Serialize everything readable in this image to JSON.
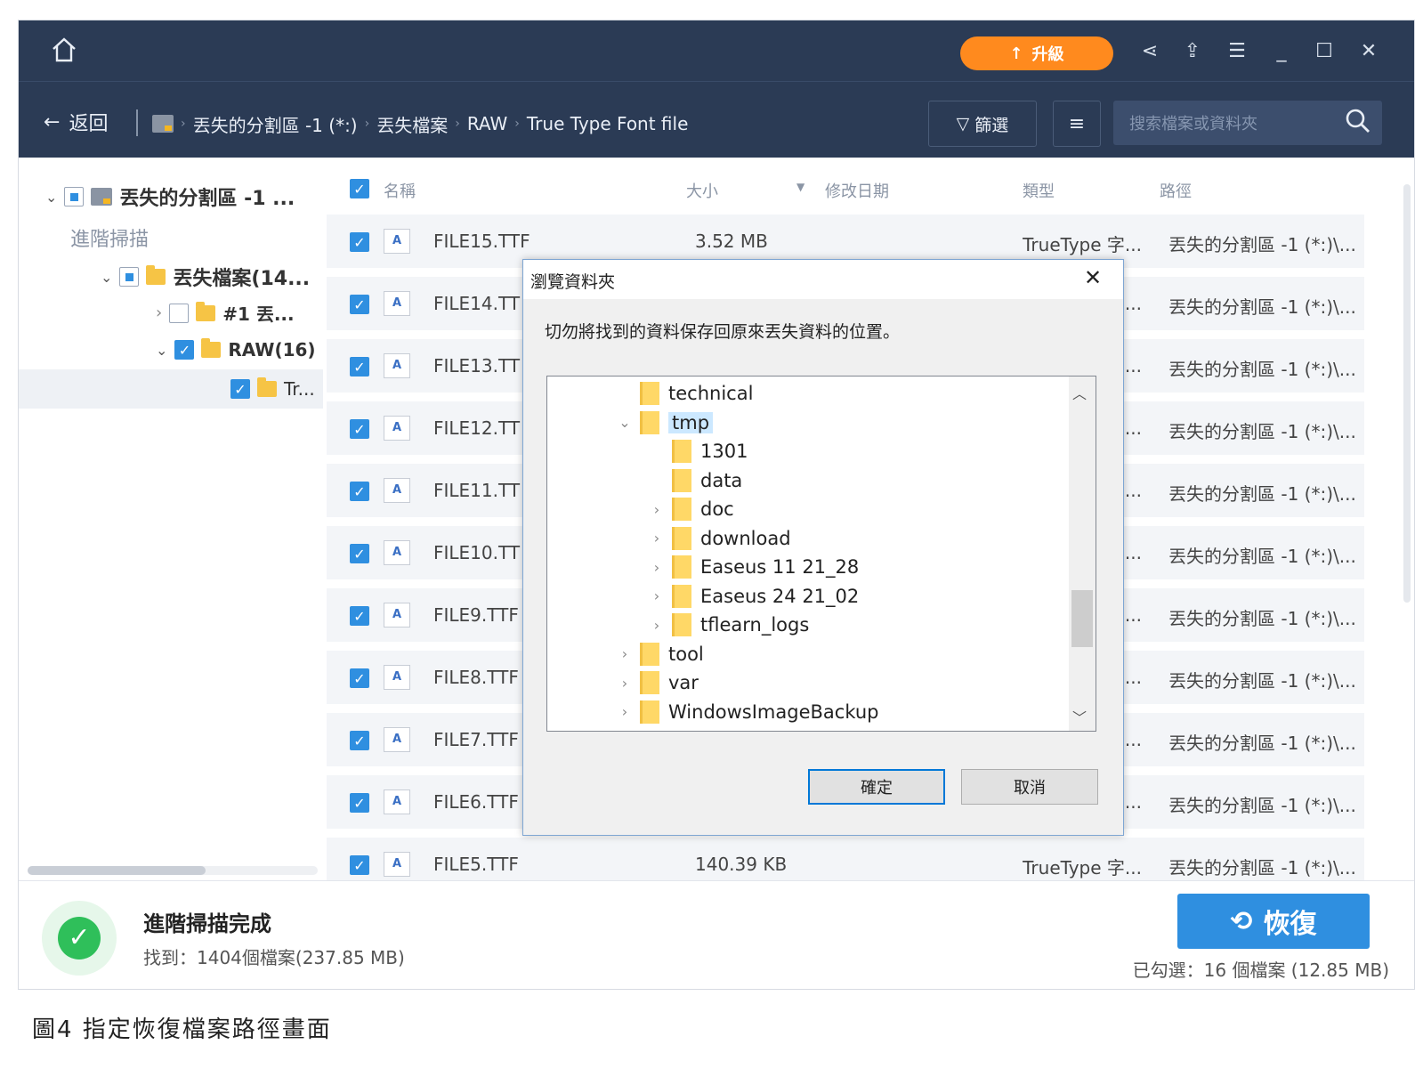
{
  "titlebar": {
    "home_icon": "home-icon",
    "upgrade_label": "升級",
    "icons": [
      "share-icon",
      "export-icon",
      "menu-icon",
      "minimize-icon",
      "maximize-icon",
      "close-icon"
    ]
  },
  "nav": {
    "back_label": "返回",
    "breadcrumb": [
      "丟失的分割區 -1 (*:)",
      "丟失檔案",
      "RAW",
      "True Type Font file"
    ],
    "filter_label": "篩選",
    "search_placeholder": "搜索檔案或資料夾"
  },
  "sidebar": {
    "root_label": "丟失的分割區 -1 ...",
    "advanced_scan_label": "進階掃描",
    "lost_files_label": "丟失檔案(14...",
    "item1_label": "#1 丟...",
    "raw_label": "RAW(16)",
    "tr_label": "Tr..."
  },
  "table": {
    "headers": {
      "name": "名稱",
      "size": "大小",
      "date": "修改日期",
      "type": "類型",
      "path": "路徑"
    },
    "rows": [
      {
        "name": "FILE15.TTF",
        "size": "3.52 MB",
        "type": "TrueType 字...",
        "path": "丟失的分割區 -1 (*:)\\..."
      },
      {
        "name": "FILE14.TT",
        "size": "",
        "type": "...",
        "path": "丟失的分割區 -1 (*:)\\..."
      },
      {
        "name": "FILE13.TT",
        "size": "",
        "type": "...",
        "path": "丟失的分割區 -1 (*:)\\..."
      },
      {
        "name": "FILE12.TT",
        "size": "",
        "type": "...",
        "path": "丟失的分割區 -1 (*:)\\..."
      },
      {
        "name": "FILE11.TT",
        "size": "",
        "type": "...",
        "path": "丟失的分割區 -1 (*:)\\..."
      },
      {
        "name": "FILE10.TT",
        "size": "",
        "type": "...",
        "path": "丟失的分割區 -1 (*:)\\..."
      },
      {
        "name": "FILE9.TTF",
        "size": "",
        "type": "...",
        "path": "丟失的分割區 -1 (*:)\\..."
      },
      {
        "name": "FILE8.TTF",
        "size": "",
        "type": "...",
        "path": "丟失的分割區 -1 (*:)\\..."
      },
      {
        "name": "FILE7.TTF",
        "size": "",
        "type": "...",
        "path": "丟失的分割區 -1 (*:)\\..."
      },
      {
        "name": "FILE6.TTF",
        "size": "",
        "type": "...",
        "path": "丟失的分割區 -1 (*:)\\..."
      },
      {
        "name": "FILE5.TTF",
        "size": "140.39 KB",
        "type": "TrueType 字...",
        "path": "丟失的分割區 -1 (*:)\\..."
      }
    ]
  },
  "dialog": {
    "title": "瀏覽資料夾",
    "warning": "切勿將找到的資料保存回原來丟失資料的位置。",
    "tree": [
      {
        "label": "technical",
        "level": 1,
        "arrow": ""
      },
      {
        "label": "tmp",
        "level": 1,
        "arrow": "⌄"
      },
      {
        "label": "1301",
        "level": 2,
        "arrow": ""
      },
      {
        "label": "data",
        "level": 2,
        "arrow": ""
      },
      {
        "label": "doc",
        "level": 2,
        "arrow": "›"
      },
      {
        "label": "download",
        "level": 2,
        "arrow": "›"
      },
      {
        "label": "Easeus 11 21_28",
        "level": 2,
        "arrow": "›"
      },
      {
        "label": "Easeus 24 21_02",
        "level": 2,
        "arrow": "›"
      },
      {
        "label": "tflearn_logs",
        "level": 2,
        "arrow": "›"
      },
      {
        "label": "tool",
        "level": 1,
        "arrow": "›"
      },
      {
        "label": "var",
        "level": 1,
        "arrow": "›"
      },
      {
        "label": "WindowsImageBackup",
        "level": 1,
        "arrow": "›"
      }
    ],
    "ok_label": "確定",
    "cancel_label": "取消"
  },
  "status": {
    "title": "進階掃描完成",
    "found": "找到：1404個檔案(237.85 MB)",
    "recover_label": "恢復",
    "selected": "已勾選：16 個檔案 (12.85 MB)"
  },
  "caption": "圖4 指定恢復檔案路徑畫面",
  "colors": {
    "header_bg": "#2b3b55",
    "accent": "#2f8fe0",
    "upgrade": "#ff8a1e",
    "success": "#2fbf5a"
  }
}
